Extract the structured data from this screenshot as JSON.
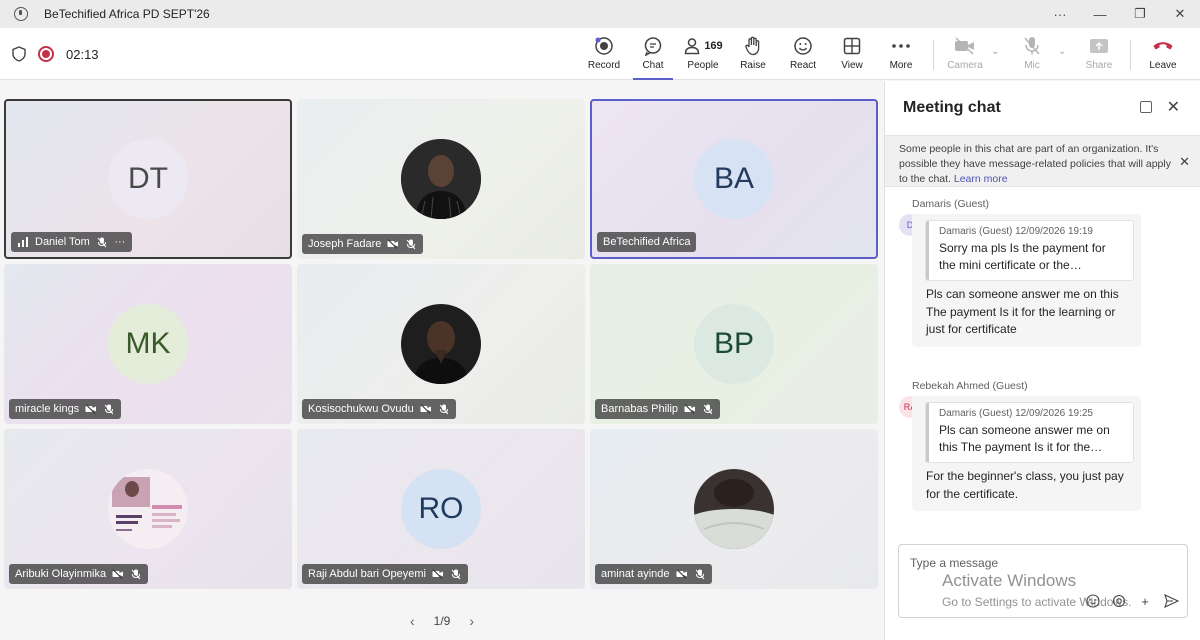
{
  "window": {
    "title": "BeTechified Africa PD SEPT'26",
    "controls": [
      "···",
      "—",
      "❐",
      "✕"
    ]
  },
  "toolbar": {
    "timer": "02:13",
    "buttons": [
      {
        "id": "record",
        "label": "Record",
        "icon": "record-icon"
      },
      {
        "id": "chat",
        "label": "Chat",
        "icon": "chat-icon",
        "active": true
      },
      {
        "id": "people",
        "label": "People",
        "icon": "people-icon",
        "count": "169"
      },
      {
        "id": "raise",
        "label": "Raise",
        "icon": "hand-icon"
      },
      {
        "id": "react",
        "label": "React",
        "icon": "smiley-icon"
      },
      {
        "id": "view",
        "label": "View",
        "icon": "grid-icon"
      },
      {
        "id": "more",
        "label": "More",
        "icon": "more-icon"
      },
      {
        "id": "camera",
        "label": "Camera",
        "icon": "camera-off-icon",
        "disabled": true
      },
      {
        "id": "mic",
        "label": "Mic",
        "icon": "mic-off-icon",
        "disabled": true
      },
      {
        "id": "share",
        "label": "Share",
        "icon": "share-icon",
        "disabled": true
      },
      {
        "id": "leave",
        "label": "Leave",
        "icon": "phone-hangup-icon"
      }
    ]
  },
  "participants": [
    {
      "name": "Daniel Tom",
      "initials": "DT",
      "bg": "#ece9f2"
    },
    {
      "name": "Joseph Fadare",
      "initials": "",
      "photo": "man-black-shirt"
    },
    {
      "name": "BeTechified Africa",
      "initials": "BA",
      "bg": "#d7e3f4"
    },
    {
      "name": "miracle kings",
      "initials": "MK",
      "bg": "#e4edd9"
    },
    {
      "name": "Kosisochukwu Ovudu",
      "initials": "",
      "photo": "man-dark-portrait"
    },
    {
      "name": "Barnabas Philip",
      "initials": "BP",
      "bg": "#dbe9e2"
    },
    {
      "name": "Aribuki Olayinmika",
      "initials": "",
      "photo": "creative-writing-flyer"
    },
    {
      "name": "Raji Abdul bari Opeyemi",
      "initials": "RO",
      "bg": "#d5e2f3"
    },
    {
      "name": "aminat ayinde",
      "initials": "",
      "photo": "dark-selfie"
    }
  ],
  "pager": {
    "text": "1/9",
    "prev": "‹",
    "next": "›"
  },
  "chat": {
    "title": "Meeting chat",
    "notice": "Some people in this chat are part of an organization. It's possible they have message-related policies that will apply to the chat.",
    "notice_link": "Learn more",
    "messages": [
      {
        "sender": "Damaris (Guest)",
        "avatar": "D",
        "avatar_bg": "#e6e0f5",
        "avatar_color": "#5b5fc7",
        "quote_header": "Damaris (Guest)   12/09/2026 19:19",
        "quote_text": "Sorry ma pls Is the payment for the mini certificate or the…",
        "body": "Pls can someone answer me on this The payment Is it for the learning or just for certificate"
      },
      {
        "sender": "Rebekah Ahmed (Guest)",
        "avatar": "RA",
        "avatar_bg": "#fbe2e6",
        "avatar_color": "#c4314b",
        "quote_header": "Damaris (Guest)   12/09/2026 19:25",
        "quote_text": "Pls can someone answer me on this The payment Is it for the…",
        "body": "For the beginner's class, you just pay for the certificate."
      }
    ],
    "composer_placeholder": "Type a message"
  },
  "watermark": {
    "line1": "Activate Windows",
    "line2": "Go to Settings to activate Windows."
  }
}
